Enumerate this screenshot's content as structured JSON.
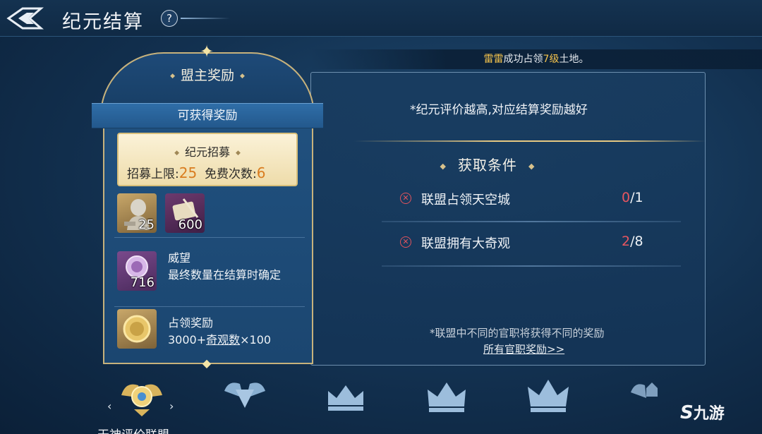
{
  "header": {
    "title": "纪元结算",
    "help_label": "?"
  },
  "announcement": {
    "name": "雷雷",
    "text_before": "成功占领",
    "level": "7级",
    "text_after": "土地。"
  },
  "reward_card": {
    "title": "盟主奖励",
    "ribbon": "可获得奖励",
    "recruit": {
      "title": "纪元招募",
      "limit_label": "招募上限:",
      "limit_value": "25",
      "free_label": "免费次数:",
      "free_value": "6"
    },
    "items": [
      {
        "icon": "statue-icon",
        "quantity": "25"
      },
      {
        "icon": "scroll-quill-icon",
        "quantity": "600"
      }
    ],
    "prestige": {
      "icon": "prestige-medal-icon",
      "quantity": "716",
      "name": "威望",
      "desc": "最终数量在结算时确定"
    },
    "occupation": {
      "icon": "gold-coin-icon",
      "name": "占领奖励",
      "desc_prefix": "3000+",
      "desc_link": "奇观数",
      "desc_suffix": "×100"
    }
  },
  "conditions": {
    "note": "*纪元评价越高,对应结算奖励越好",
    "title": "获取条件",
    "items": [
      {
        "label": "联盟占领天空城",
        "current": "0",
        "total": "/1"
      },
      {
        "label": "联盟拥有大奇观",
        "current": "2",
        "total": "/8"
      }
    ],
    "footer_note": "*联盟中不同的官职将获得不同的奖励",
    "footer_link": "所有官职奖励>>"
  },
  "tiers": {
    "selected_label": "天神评价联盟",
    "icons": [
      "winged-emblem-icon",
      "winged-diamond-icon",
      "crown-icon",
      "crown-icon",
      "crown-icon",
      "winged-crown-icon"
    ],
    "prev": "‹",
    "next": "›"
  },
  "watermark": {
    "glyph": "S",
    "text": "九游"
  },
  "colors": {
    "accent_gold": "#e6c882",
    "fail_red": "#e85660",
    "highlight_orange": "#d97c1f"
  }
}
